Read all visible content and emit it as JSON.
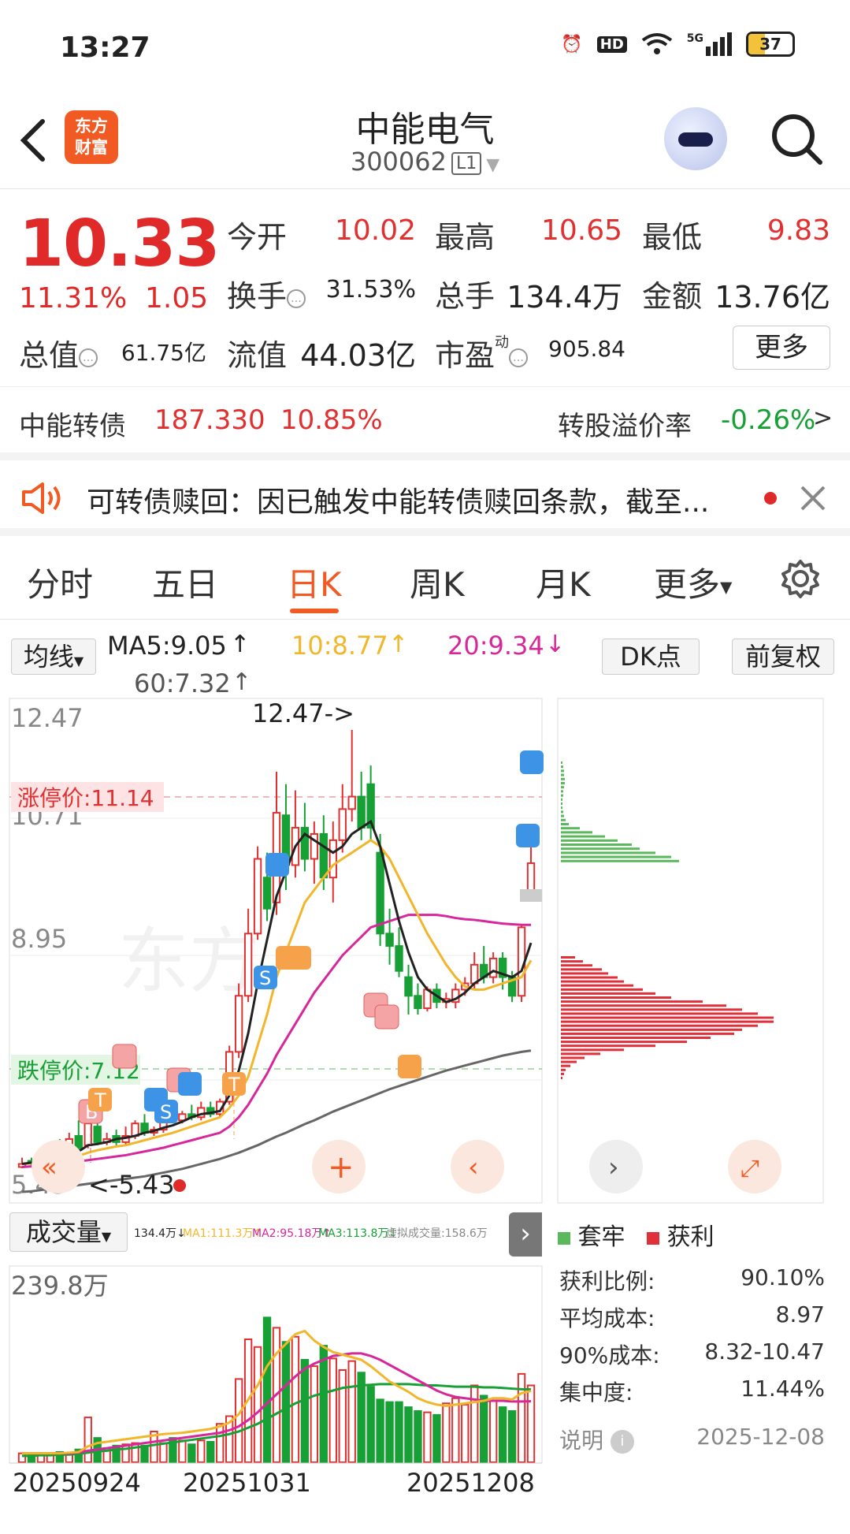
{
  "status_bar": {
    "time": "13:27",
    "network": "5G",
    "battery": "37"
  },
  "header": {
    "stock_name": "中能电气",
    "stock_code": "300062",
    "level": "L1",
    "logo_text_1": "东方",
    "logo_text_2": "财富"
  },
  "quote": {
    "price": "10.33",
    "change_pct": "11.31%",
    "change": "1.05",
    "open_label": "今开",
    "open": "10.02",
    "high_label": "最高",
    "high": "10.65",
    "low_label": "最低",
    "low": "9.83",
    "turnover_label": "换手",
    "turnover": "31.53%",
    "volume_label": "总手",
    "volume": "134.4万",
    "amount_label": "金额",
    "amount": "13.76亿",
    "mktcap_label": "总值",
    "mktcap": "61.75亿",
    "float_label": "流值",
    "float": "44.03亿",
    "pe_label": "市盈",
    "pe_sup": "动",
    "pe": "905.84",
    "more_label": "更多"
  },
  "bond": {
    "name": "中能转债",
    "price": "187.330",
    "pct": "10.85%",
    "premium_label": "转股溢价率",
    "premium": "-0.26%",
    "arrow": ">"
  },
  "notice": {
    "text": "可转债赎回：因已触发中能转债赎回条款，截至..."
  },
  "tabs": [
    "分时",
    "五日",
    "日K",
    "周K",
    "月K",
    "更多"
  ],
  "ma_row": {
    "selector": "均线",
    "ma5": "MA5:9.05",
    "ma10": "10:8.77",
    "ma20": "20:9.34",
    "ma60": "60:7.32",
    "dk_btn": "DK点",
    "adjust_btn": "前复权"
  },
  "colors": {
    "up": "#e03030",
    "down": "#17a035",
    "accent": "#f15a22",
    "ma5": "#222222",
    "ma10": "#f2b62b",
    "ma20": "#d6279b",
    "ma60": "#666666",
    "dist_trapped": "#5cb85c",
    "dist_profit": "#e0303a"
  },
  "kline": {
    "y_labels": [
      "12.47",
      "10.71",
      "8.95",
      "5.43"
    ],
    "limit_up_label": "涨停价:11.14",
    "limit_down_label": "跌停价:7.12",
    "max_marker": "12.47->",
    "min_marker": "<-5.43",
    "signals": [
      "B",
      "T",
      "S",
      "T",
      "S"
    ]
  },
  "volume": {
    "selector": "成交量",
    "legend": {
      "vol": "134.4万↓",
      "ma1": "MA1:111.3万↑",
      "ma2": "MA2:95.18万↑",
      "ma3": "MA3:113.8万↓",
      "virtual": "虚拟成交量:158.6万"
    },
    "y_label": "239.8万"
  },
  "dates": [
    "20250924",
    "20251031",
    "20251208"
  ],
  "chip": {
    "legend_trapped": "套牢",
    "legend_profit": "获利",
    "profit_ratio_label": "获利比例:",
    "profit_ratio": "90.10%",
    "avg_cost_label": "平均成本:",
    "avg_cost": "8.97",
    "cost90_label": "90%成本:",
    "cost90": "8.32-10.47",
    "concentration_label": "集中度:",
    "concentration": "11.44%",
    "note_label": "说明",
    "date": "2025-12-08"
  },
  "chart_data": {
    "type": "candlestick",
    "ylim": [
      5.0,
      12.8
    ],
    "candles": [
      {
        "o": 5.45,
        "c": 5.5,
        "h": 5.6,
        "l": 5.43
      },
      {
        "o": 5.55,
        "c": 5.52,
        "h": 5.6,
        "l": 5.48
      },
      {
        "o": 5.52,
        "c": 5.6,
        "h": 5.65,
        "l": 5.5
      },
      {
        "o": 5.6,
        "c": 5.75,
        "h": 5.8,
        "l": 5.55
      },
      {
        "o": 5.75,
        "c": 5.7,
        "h": 5.9,
        "l": 5.65
      },
      {
        "o": 5.7,
        "c": 5.9,
        "h": 6.0,
        "l": 5.68
      },
      {
        "o": 5.95,
        "c": 5.75,
        "h": 6.2,
        "l": 5.7
      },
      {
        "o": 5.8,
        "c": 6.15,
        "h": 6.45,
        "l": 5.75
      },
      {
        "o": 6.1,
        "c": 5.85,
        "h": 6.2,
        "l": 5.8
      },
      {
        "o": 5.85,
        "c": 5.9,
        "h": 6.0,
        "l": 5.8
      },
      {
        "o": 5.95,
        "c": 5.85,
        "h": 6.05,
        "l": 5.8
      },
      {
        "o": 5.85,
        "c": 5.95,
        "h": 6.1,
        "l": 5.8
      },
      {
        "o": 5.95,
        "c": 6.15,
        "h": 6.2,
        "l": 5.9
      },
      {
        "o": 6.15,
        "c": 6.0,
        "h": 6.3,
        "l": 5.95
      },
      {
        "o": 6.0,
        "c": 6.05,
        "h": 6.1,
        "l": 5.95
      },
      {
        "o": 6.05,
        "c": 6.35,
        "h": 6.4,
        "l": 6.0
      },
      {
        "o": 6.3,
        "c": 6.2,
        "h": 6.4,
        "l": 6.15
      },
      {
        "o": 6.2,
        "c": 6.3,
        "h": 6.35,
        "l": 6.15
      },
      {
        "o": 6.3,
        "c": 6.25,
        "h": 6.45,
        "l": 6.2
      },
      {
        "o": 6.25,
        "c": 6.4,
        "h": 6.5,
        "l": 6.2
      },
      {
        "o": 6.4,
        "c": 6.3,
        "h": 6.5,
        "l": 6.25
      },
      {
        "o": 6.3,
        "c": 6.5,
        "h": 6.55,
        "l": 6.25
      },
      {
        "o": 6.5,
        "c": 7.3,
        "h": 7.4,
        "l": 6.45
      },
      {
        "o": 7.3,
        "c": 8.2,
        "h": 8.4,
        "l": 7.2
      },
      {
        "o": 8.2,
        "c": 9.2,
        "h": 9.6,
        "l": 8.1
      },
      {
        "o": 9.2,
        "c": 10.4,
        "h": 10.6,
        "l": 9.1
      },
      {
        "o": 10.1,
        "c": 9.6,
        "h": 10.5,
        "l": 9.4
      },
      {
        "o": 9.7,
        "c": 11.14,
        "h": 11.8,
        "l": 9.5
      },
      {
        "o": 11.1,
        "c": 10.3,
        "h": 11.6,
        "l": 9.9
      },
      {
        "o": 10.3,
        "c": 10.9,
        "h": 11.5,
        "l": 10.1
      },
      {
        "o": 10.9,
        "c": 10.4,
        "h": 11.3,
        "l": 10.2
      },
      {
        "o": 10.4,
        "c": 10.8,
        "h": 11.0,
        "l": 10.0
      },
      {
        "o": 10.8,
        "c": 10.1,
        "h": 11.1,
        "l": 9.9
      },
      {
        "o": 10.1,
        "c": 10.7,
        "h": 11.0,
        "l": 9.7
      },
      {
        "o": 10.7,
        "c": 11.2,
        "h": 11.6,
        "l": 10.5
      },
      {
        "o": 11.2,
        "c": 11.4,
        "h": 12.47,
        "l": 11.0
      },
      {
        "o": 11.4,
        "c": 10.9,
        "h": 11.8,
        "l": 10.7
      },
      {
        "o": 11.6,
        "c": 10.9,
        "h": 11.9,
        "l": 10.7
      },
      {
        "o": 10.5,
        "c": 9.2,
        "h": 10.8,
        "l": 9.0
      },
      {
        "o": 9.2,
        "c": 9.0,
        "h": 9.6,
        "l": 8.7
      },
      {
        "o": 9.0,
        "c": 8.6,
        "h": 9.3,
        "l": 8.5
      },
      {
        "o": 8.5,
        "c": 8.2,
        "h": 8.7,
        "l": 7.9
      },
      {
        "o": 8.2,
        "c": 8.0,
        "h": 8.4,
        "l": 7.9
      },
      {
        "o": 8.0,
        "c": 8.3,
        "h": 8.35,
        "l": 7.95
      },
      {
        "o": 8.3,
        "c": 8.1,
        "h": 8.4,
        "l": 8.0
      },
      {
        "o": 8.1,
        "c": 8.15,
        "h": 8.25,
        "l": 8.0
      },
      {
        "o": 8.1,
        "c": 8.3,
        "h": 8.4,
        "l": 8.0
      },
      {
        "o": 8.3,
        "c": 8.4,
        "h": 8.5,
        "l": 8.2
      },
      {
        "o": 8.4,
        "c": 8.7,
        "h": 8.9,
        "l": 8.3
      },
      {
        "o": 8.7,
        "c": 8.5,
        "h": 9.0,
        "l": 8.4
      },
      {
        "o": 8.5,
        "c": 8.8,
        "h": 8.9,
        "l": 8.4
      },
      {
        "o": 8.8,
        "c": 8.5,
        "h": 8.9,
        "l": 8.3
      },
      {
        "o": 8.5,
        "c": 8.2,
        "h": 8.6,
        "l": 8.1
      },
      {
        "o": 8.2,
        "c": 9.3,
        "h": 9.35,
        "l": 8.1
      },
      {
        "o": 9.83,
        "c": 10.33,
        "h": 10.65,
        "l": 9.83
      }
    ],
    "ma5": [
      5.5,
      5.52,
      5.55,
      5.58,
      5.62,
      5.68,
      5.7,
      5.8,
      5.82,
      5.85,
      5.9,
      5.92,
      5.95,
      6.0,
      6.03,
      6.08,
      6.12,
      6.18,
      6.25,
      6.3,
      6.32,
      6.35,
      6.6,
      7.0,
      7.6,
      8.4,
      9.1,
      9.8,
      10.2,
      10.6,
      10.8,
      10.7,
      10.6,
      10.5,
      10.6,
      10.8,
      10.9,
      11.0,
      10.6,
      10.0,
      9.4,
      8.9,
      8.5,
      8.3,
      8.2,
      8.1,
      8.15,
      8.25,
      8.4,
      8.5,
      8.6,
      8.55,
      8.5,
      8.6,
      9.05
    ],
    "ma10": [
      5.5,
      5.51,
      5.53,
      5.55,
      5.57,
      5.6,
      5.63,
      5.68,
      5.72,
      5.75,
      5.78,
      5.8,
      5.84,
      5.88,
      5.92,
      5.96,
      6.0,
      6.05,
      6.1,
      6.15,
      6.2,
      6.25,
      6.4,
      6.6,
      6.9,
      7.4,
      7.9,
      8.5,
      8.9,
      9.3,
      9.7,
      9.9,
      10.1,
      10.3,
      10.4,
      10.5,
      10.6,
      10.7,
      10.6,
      10.4,
      10.1,
      9.8,
      9.5,
      9.2,
      8.95,
      8.7,
      8.5,
      8.35,
      8.3,
      8.3,
      8.35,
      8.4,
      8.45,
      8.5,
      8.77
    ],
    "ma20": [
      5.45,
      5.46,
      5.47,
      5.48,
      5.5,
      5.52,
      5.54,
      5.56,
      5.58,
      5.6,
      5.62,
      5.64,
      5.67,
      5.7,
      5.73,
      5.76,
      5.8,
      5.84,
      5.88,
      5.92,
      5.96,
      6.0,
      6.1,
      6.25,
      6.45,
      6.7,
      6.95,
      7.25,
      7.5,
      7.75,
      8.0,
      8.25,
      8.45,
      8.65,
      8.85,
      9.0,
      9.15,
      9.3,
      9.35,
      9.4,
      9.45,
      9.5,
      9.5,
      9.5,
      9.5,
      9.48,
      9.45,
      9.43,
      9.42,
      9.4,
      9.38,
      9.36,
      9.35,
      9.34,
      9.34
    ],
    "ma60": [
      5.05,
      5.06,
      5.08,
      5.1,
      5.12,
      5.14,
      5.16,
      5.18,
      5.2,
      5.22,
      5.24,
      5.26,
      5.28,
      5.3,
      5.33,
      5.36,
      5.39,
      5.42,
      5.46,
      5.5,
      5.54,
      5.58,
      5.63,
      5.68,
      5.74,
      5.8,
      5.87,
      5.94,
      6.0,
      6.07,
      6.14,
      6.2,
      6.27,
      6.34,
      6.4,
      6.46,
      6.52,
      6.58,
      6.64,
      6.7,
      6.75,
      6.8,
      6.85,
      6.9,
      6.95,
      7.0,
      7.04,
      7.08,
      7.12,
      7.16,
      7.2,
      7.24,
      7.27,
      7.3,
      7.32
    ],
    "volumes": [
      14,
      14,
      13,
      13,
      16,
      14,
      20,
      70,
      38,
      22,
      26,
      28,
      30,
      26,
      48,
      30,
      38,
      34,
      28,
      34,
      32,
      60,
      72,
      130,
      192,
      180,
      226,
      210,
      188,
      196,
      160,
      150,
      182,
      162,
      144,
      158,
      140,
      118,
      98,
      94,
      94,
      86,
      80,
      78,
      74,
      92,
      100,
      90,
      120,
      104,
      96,
      86,
      80,
      138,
      120
    ],
    "vol_ma1": [
      14,
      14,
      14,
      14,
      14,
      15,
      16,
      25,
      30,
      32,
      34,
      36,
      38,
      40,
      42,
      44,
      45,
      46,
      48,
      50,
      52,
      56,
      62,
      75,
      98,
      120,
      150,
      170,
      185,
      200,
      205,
      190,
      180,
      172,
      168,
      164,
      160,
      150,
      138,
      126,
      118,
      110,
      100,
      94,
      90,
      88,
      90,
      92,
      94,
      96,
      100,
      100,
      98,
      108,
      111.3
    ],
    "vol_ma2": [
      14,
      14,
      14,
      14,
      14,
      14,
      15,
      18,
      20,
      22,
      24,
      26,
      28,
      30,
      32,
      34,
      36,
      38,
      40,
      42,
      44,
      46,
      50,
      56,
      66,
      78,
      92,
      106,
      120,
      134,
      146,
      154,
      160,
      166,
      168,
      170,
      170,
      166,
      160,
      152,
      144,
      136,
      128,
      120,
      112,
      106,
      102,
      100,
      98,
      96,
      96,
      96,
      95,
      95,
      95.18
    ],
    "vol_ma3": [
      10,
      10,
      11,
      11,
      12,
      12,
      13,
      15,
      17,
      18,
      20,
      21,
      23,
      25,
      27,
      29,
      31,
      33,
      35,
      37,
      39,
      41,
      44,
      48,
      54,
      60,
      68,
      76,
      84,
      92,
      98,
      104,
      108,
      112,
      116,
      118,
      120,
      121,
      122,
      122,
      122,
      122,
      121,
      120,
      120,
      119,
      118,
      118,
      118,
      117,
      117,
      116,
      115,
      114,
      113.8
    ],
    "chip_profit": [
      0,
      0,
      0,
      0,
      0,
      0,
      0,
      0,
      0,
      0,
      0,
      0,
      0,
      0,
      0,
      0,
      0,
      0,
      0,
      0,
      0,
      0,
      0,
      0,
      0,
      0,
      0,
      0,
      0,
      0,
      18,
      28,
      40,
      52,
      60,
      72,
      80,
      92,
      104,
      120,
      140,
      180,
      210,
      230,
      250,
      270,
      270,
      250,
      230,
      220,
      190,
      160,
      120,
      80,
      50,
      30,
      20,
      12,
      6,
      4,
      2
    ],
    "chip_trapped_top": [
      0,
      0,
      0,
      0,
      0,
      2,
      3,
      4,
      4,
      5,
      5,
      4,
      3,
      3,
      2,
      2,
      2,
      3,
      4,
      6,
      10,
      24,
      40,
      56,
      72,
      90,
      100,
      120,
      140,
      150
    ]
  }
}
